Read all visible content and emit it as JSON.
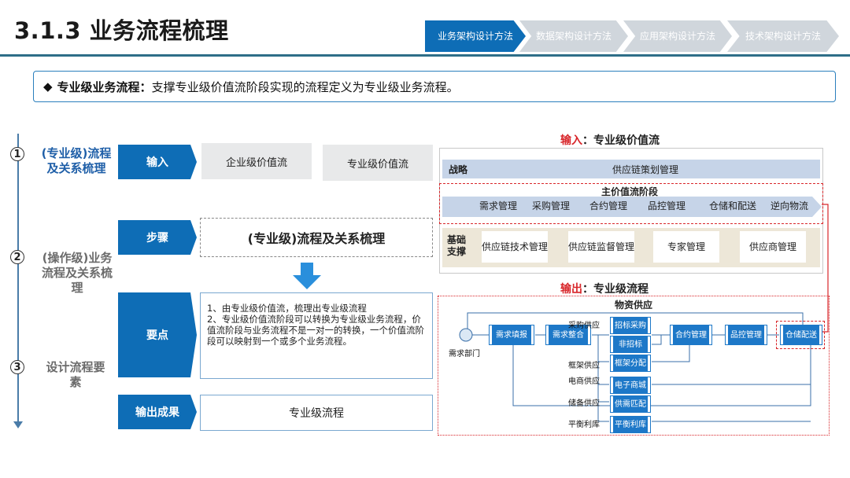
{
  "header": {
    "title": "3.1.3 业务流程梳理",
    "steps": [
      "业务架构设计方法",
      "数据架构设计方法",
      "应用架构设计方法",
      "技术架构设计方法"
    ]
  },
  "banner": {
    "marker": "◆",
    "label": "专业级业务流程：",
    "text": "支撑专业级价值流阶段实现的流程定义为专业级业务流程。"
  },
  "phases": [
    {
      "num": "1",
      "text": "(专业级)流程及关系梳理"
    },
    {
      "num": "2",
      "text": "(操作级)业务流程及关系梳理"
    },
    {
      "num": "3",
      "text": "设计流程要素"
    }
  ],
  "rows": {
    "input": {
      "label": "输入",
      "items": [
        "企业级价值流",
        "专业级价值流"
      ]
    },
    "step": {
      "label": "步骤",
      "text": "(专业级)流程及关系梳理"
    },
    "points": {
      "label": "要点",
      "lines": [
        "1、由专业级价值流，梳理出专业级流程",
        "2、专业级价值流阶段可以转换为专业级业务流程，价值流阶段与业务流程不是一对一的转换，一个价值流阶段可以映射到一个或多个业务流程。"
      ]
    },
    "output": {
      "label": "输出成果",
      "text": "专业级流程"
    }
  },
  "value_chain": {
    "caption_prefix": "输入",
    "caption_text": "：专业级价值流",
    "strategy_label": "战略",
    "strategy_text": "供应链策划管理",
    "main_title": "主价值流阶段",
    "main_stages": [
      "需求管理",
      "采购管理",
      "合约管理",
      "品控管理",
      "仓储和配送",
      "逆向物流"
    ],
    "support_label": "基础支撑",
    "support_items": [
      "供应链技术管理",
      "供应链监督管理",
      "专家管理",
      "供应商管理"
    ]
  },
  "process_flow": {
    "caption_prefix": "输出",
    "caption_text": "：专业级流程",
    "title": "物资供应",
    "actor": "需求部门",
    "nodes": [
      "需求填报",
      "需求整合",
      "招标采购",
      "非招标",
      "框架分配",
      "电子商城",
      "供需匹配",
      "平衡利库",
      "合约管理",
      "品控管理",
      "仓储配送"
    ],
    "branch_labels": [
      "采购供应",
      "框架供应",
      "电商供应",
      "储备供应",
      "平衡利库"
    ]
  },
  "colors": {
    "accent": "#0e6db6",
    "highlight_red": "#d8262a",
    "inactive_step": "#d0d6dc"
  }
}
